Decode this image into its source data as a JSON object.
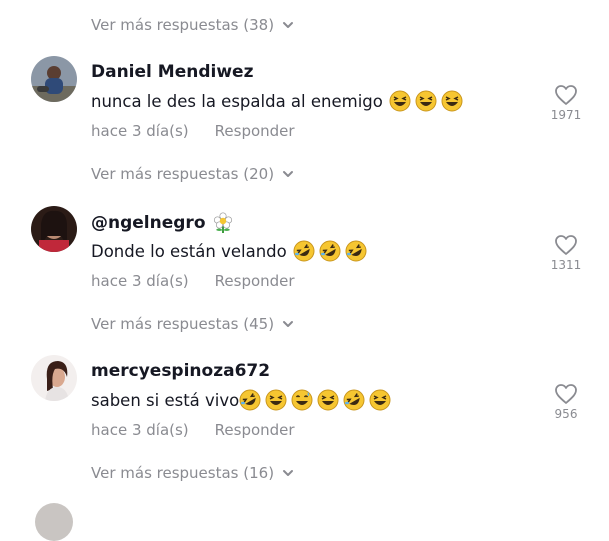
{
  "top_more": {
    "label": "Ver más respuestas (38)"
  },
  "comments": [
    {
      "username": "Daniel Mendiwez",
      "text": "nunca le des la espalda al enemigo",
      "emojis": [
        "grinning-squint-face",
        "grinning-squint-face",
        "grinning-squint-face"
      ],
      "time": "hace 3 día(s)",
      "reply": "Responder",
      "likes": "1971",
      "more": "Ver más respuestas (20)"
    },
    {
      "username": "@ngelnegro",
      "username_emoji": "blossom",
      "text": "Donde lo están velando",
      "emojis": [
        "rolling-laughing-face",
        "rolling-laughing-face",
        "rolling-laughing-face"
      ],
      "time": "hace 3 día(s)",
      "reply": "Responder",
      "likes": "1311",
      "more": "Ver más respuestas (45)"
    },
    {
      "username": "mercyespinoza672",
      "text": "saben si está vivo",
      "emojis": [
        "rolling-laughing-face",
        "grinning-squint-face",
        "grinning-sweat-face",
        "grinning-squint-face",
        "rolling-laughing-face",
        "grinning-squint-face"
      ],
      "time": "hace 3 día(s)",
      "reply": "Responder",
      "likes": "956",
      "more": "Ver más respuestas (16)"
    }
  ],
  "colors": {
    "text": "#161823",
    "muted": "#8a8b91",
    "emoji_yellow": "#f6c631"
  }
}
